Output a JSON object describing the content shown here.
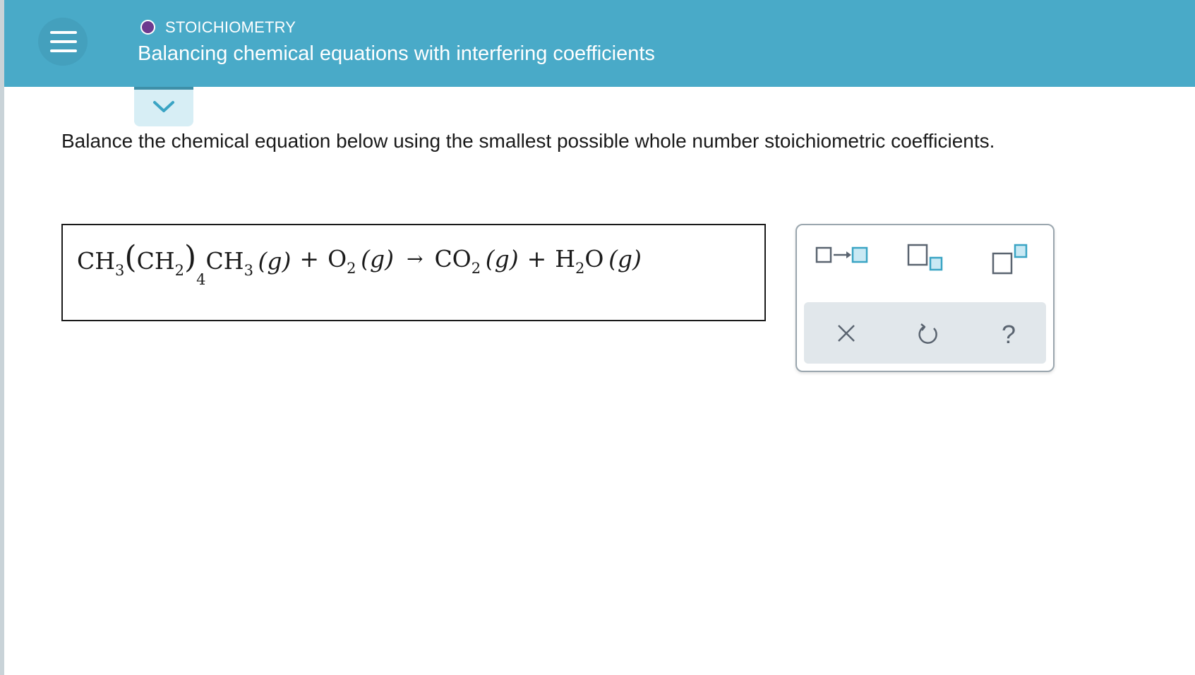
{
  "header": {
    "topic": "STOICHIOMETRY",
    "title": "Balancing chemical equations with interfering coefficients",
    "background_color": "#49aac8",
    "topic_dot_color": "#6d3a8f"
  },
  "icons": {
    "menu": "hamburger-menu-icon",
    "collapse": "chevron-down-icon",
    "clear": "x-icon",
    "undo": "undo-icon",
    "help": "question-mark-icon"
  },
  "question": {
    "instruction": "Balance the chemical equation below using the smallest possible whole number stoichiometric coefficients."
  },
  "equation": {
    "reactant1": {
      "ch": "CH",
      "sub_a": "3",
      "open_paren": "(",
      "ch2": "CH",
      "sub_b": "2",
      "close_paren": ")",
      "sub_n": "4",
      "ch_end": "CH",
      "sub_c": "3",
      "phase": "(g)"
    },
    "plus1": "+",
    "reactant2": {
      "o": "O",
      "sub": "2",
      "phase": "(g)"
    },
    "arrow": "→",
    "product1": {
      "co": "CO",
      "sub": "2",
      "phase": "(g)"
    },
    "plus2": "+",
    "product2": {
      "h": "H",
      "sub": "2",
      "o": "O",
      "phase": "(g)"
    }
  },
  "toolbox": {
    "tools": [
      "coefficient-arrow-tool",
      "subscript-tool",
      "superscript-tool"
    ],
    "help_label": "?"
  }
}
